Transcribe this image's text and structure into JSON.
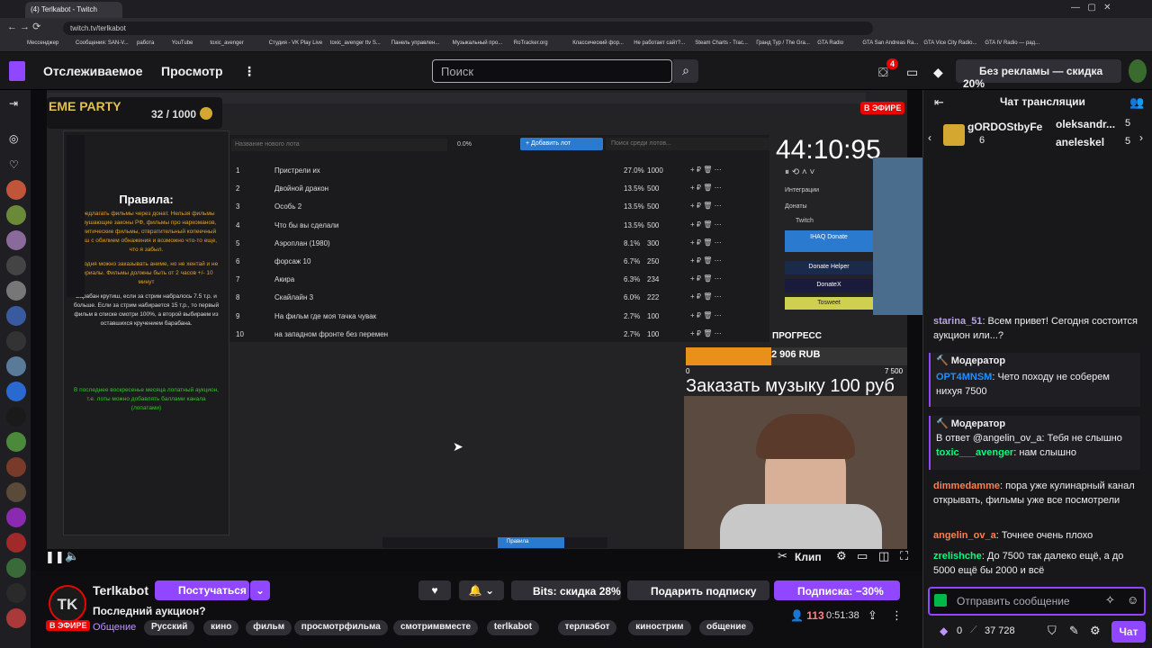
{
  "browser": {
    "tab_title": "(4) Terlkabot - Twitch",
    "url": "twitch.tv/terlkabot",
    "bookmarks": [
      "Мессенджер",
      "Сообщения: SAN-V...",
      "работа",
      "YouTube",
      "toxic_avenger",
      "Студия - VK Play Live",
      "toxic_avenger ttv S...",
      "Панель управлен...",
      "Музыкальный про...",
      "RoTracker.org",
      "Классический фор...",
      "Не работает сайт?...",
      "Steam Charts - Trac...",
      "Гранд Тур / The Gra...",
      "GTA Radio",
      "GTA San Andreas Ra...",
      "GTA Vice City Radio...",
      "GTA IV Radio — рад..."
    ]
  },
  "nav": {
    "following": "Отслеживаемое",
    "browse": "Просмотр",
    "search_placeholder": "Поиск",
    "notif_count": "4",
    "adfree": "Без рекламы — скидка 20%"
  },
  "stream": {
    "live_badge": "В ЭФИРЕ",
    "counter": "32 / 1000",
    "banner": "EME PARTY",
    "rules_title": "Правила:",
    "rules_text": "Предлагать фильмы через донат. Нельзя фильмы нарушающие законы РФ, фильмы про наркоманов, политические фильмы, отвратительный копеечный треш с обилием обнажения и возможно что-то еще, что я забыл.",
    "rules_text2": "Сегодня можно заказывать аниме, но не хентай и не сериалы. Фильмы должны быть от 2 часов +/- 10 минут",
    "rules_text3": "Барабан крутиш, если за стрим набралось 7.5 т.р. и больше. Если за стрим набирается 15 т.р., то первый фильм в списке смотри 100%, а второй выбираем из оставшихся кручением барабана.",
    "rules_text4": "В последнее воскресенье месяца лопатный аукцион, т.е. лоты можно добавлять баллами канала (лопатами)",
    "lot_placeholder": "Название нового лота",
    "lot_pct": "0.0%",
    "add_lot": "+ Добавить лот",
    "search_lots": "Поиск среди лотов...",
    "rows": [
      {
        "n": "1",
        "name": "Пристрели их",
        "pct": "27.0%",
        "val": "1000"
      },
      {
        "n": "2",
        "name": "Двойной дракон",
        "pct": "13.5%",
        "val": "500"
      },
      {
        "n": "3",
        "name": "Особь 2",
        "pct": "13.5%",
        "val": "500"
      },
      {
        "n": "4",
        "name": "Что бы вы сделали",
        "pct": "13.5%",
        "val": "500"
      },
      {
        "n": "5",
        "name": "Аэроплан (1980)",
        "pct": "8.1%",
        "val": "300"
      },
      {
        "n": "6",
        "name": "форсаж 10",
        "pct": "6.7%",
        "val": "250"
      },
      {
        "n": "7",
        "name": "Акира",
        "pct": "6.3%",
        "val": "234"
      },
      {
        "n": "8",
        "name": "Скайлайн 3",
        "pct": "6.0%",
        "val": "222"
      },
      {
        "n": "9",
        "name": "На фильм где моя тачка чувак",
        "pct": "2.7%",
        "val": "100"
      },
      {
        "n": "10",
        "name": "на западном фронте без перемен",
        "pct": "2.7%",
        "val": "100"
      }
    ],
    "timer": "44:10:95",
    "integrations": "Интеграции",
    "donations": "Донаты",
    "twitch": "Twitch",
    "donate_ihaq": "IHAQ Donate",
    "donate_helper": "Donate Helper",
    "donatex": "DonateX",
    "tosweet": "Tosweet",
    "progress_label": "ПРОГРЕСС",
    "progress_amount": "2 906 RUB",
    "progress_min": "0",
    "progress_max": "7 500",
    "progress_fraction": 0.387,
    "music_text": "Заказать музыку 100 руб",
    "rules_btn": "Правила",
    "clip": "Клип"
  },
  "chat": {
    "header": "Чат трансляции",
    "gift_user": "gORDOStbyFe",
    "gift_count": "6",
    "top1": "oleksandr...",
    "top1_n": "5",
    "top2": "aneleskel",
    "top2_n": "5",
    "messages": [
      {
        "user": "starina_51",
        "color": "#b9a3e3",
        "text": ": Всем привет! Сегодня состоится аукцион или...?"
      },
      {
        "user": "dimmedamme",
        "color": "#ff7f50",
        "text": ": пора уже кулинарный канал открывать, фильмы уже все посмотрели"
      },
      {
        "user": "angelin_ov_a",
        "color": "#ff7f50",
        "text": ": Точнее очень плохо"
      },
      {
        "user": "zrelishche",
        "color": "#00ff7f",
        "text": ": До 7500 так далеко ещё, а до 5000 ещё бы 2000 и всё"
      }
    ],
    "mod_label": "Модератор",
    "mod1_user": "OPT4MNSM",
    "mod1_text": ": Чето походу не соберем нихуя 7500",
    "mod2_reply": "В ответ @angelin_ov_a: Тебя не слышно",
    "mod2_user": "toxic___avenger",
    "mod2_text": ": нам слышно",
    "input_placeholder": "Отправить сообщение",
    "points": "0",
    "balance": "37 728",
    "chat_button": "Чат"
  },
  "info": {
    "channel": "Terlkabot",
    "live": "В ЭФИРЕ",
    "title": "Последний аукцион?",
    "category": "Общение",
    "subscribe_btn": "Постучаться",
    "bits": "Bits: скидка 28%",
    "gift_sub": "Подарить подписку",
    "sub_discount": "Подписка: −30%",
    "viewers": "113",
    "uptime": "0:51:38",
    "tags": [
      "Русский",
      "кино",
      "фильм",
      "просмотрфильма",
      "смотримвместе",
      "terlkabot",
      "терлкэбот",
      "кинострим",
      "общение"
    ]
  },
  "colors": {
    "accent": "#9147ff",
    "live": "#eb0400",
    "bg": "#0e0e10"
  }
}
